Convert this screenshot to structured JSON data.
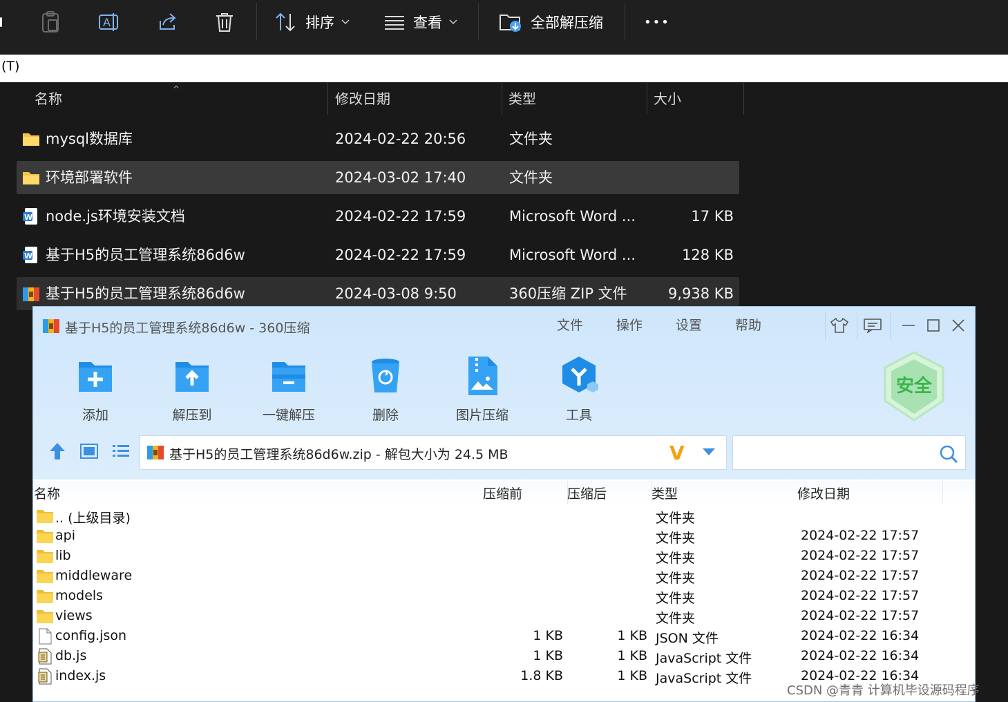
{
  "explorer": {
    "toolbar": {
      "sort_label": "排序",
      "view_label": "查看",
      "extract_all_label": "全部解压缩",
      "more_label": "•••"
    },
    "path_text": "(T)",
    "columns": {
      "name": "名称",
      "modified": "修改日期",
      "type": "类型",
      "size": "大小"
    },
    "rows": [
      {
        "name": "mysql数据库",
        "modified": "2024-02-22 20:56",
        "type": "文件夹",
        "size": "",
        "icon": "folder-icon"
      },
      {
        "name": "环境部署软件",
        "modified": "2024-03-02 17:40",
        "type": "文件夹",
        "size": "",
        "icon": "folder-icon"
      },
      {
        "name": "node.js环境安装文档",
        "modified": "2024-02-22 17:59",
        "type": "Microsoft Word ...",
        "size": "17 KB",
        "icon": "word-doc-icon"
      },
      {
        "name": "基于H5的员工管理系统86d6w",
        "modified": "2024-02-22 17:59",
        "type": "Microsoft Word ...",
        "size": "128 KB",
        "icon": "word-doc-icon"
      },
      {
        "name": "基于H5的员工管理系统86d6w",
        "modified": "2024-03-08 9:50",
        "type": "360压缩 ZIP 文件",
        "size": "9,938 KB",
        "icon": "zip-archive-icon"
      }
    ]
  },
  "zip_window": {
    "title": "基于H5的员工管理系统86d6w - 360压缩",
    "menu": [
      "文件",
      "操作",
      "设置",
      "帮助"
    ],
    "tools": [
      {
        "label": "添加",
        "icon": "add-icon"
      },
      {
        "label": "解压到",
        "icon": "extract-to-icon"
      },
      {
        "label": "一键解压",
        "icon": "one-click-extract-icon"
      },
      {
        "label": "删除",
        "icon": "delete-icon"
      },
      {
        "label": "图片压缩",
        "icon": "image-compress-icon"
      },
      {
        "label": "工具",
        "icon": "tools-icon"
      }
    ],
    "security_badge": "安全",
    "address": "基于H5的员工管理系统86d6w.zip - 解包大小为 24.5 MB",
    "address_v": "V",
    "search_placeholder": "",
    "columns": {
      "name": "名称",
      "before": "压缩前",
      "after": "压缩后",
      "type": "类型",
      "modified": "修改日期"
    },
    "rows": [
      {
        "name": ".. (上级目录)",
        "before": "",
        "after": "",
        "type": "文件夹",
        "modified": "",
        "icon": "folder-icon"
      },
      {
        "name": "api",
        "before": "",
        "after": "",
        "type": "文件夹",
        "modified": "2024-02-22 17:57",
        "icon": "folder-icon"
      },
      {
        "name": "lib",
        "before": "",
        "after": "",
        "type": "文件夹",
        "modified": "2024-02-22 17:57",
        "icon": "folder-icon"
      },
      {
        "name": "middleware",
        "before": "",
        "after": "",
        "type": "文件夹",
        "modified": "2024-02-22 17:57",
        "icon": "folder-icon"
      },
      {
        "name": "models",
        "before": "",
        "after": "",
        "type": "文件夹",
        "modified": "2024-02-22 17:57",
        "icon": "folder-icon"
      },
      {
        "name": "views",
        "before": "",
        "after": "",
        "type": "文件夹",
        "modified": "2024-02-22 17:57",
        "icon": "folder-icon"
      },
      {
        "name": "config.json",
        "before": "1 KB",
        "after": "1 KB",
        "type": "JSON 文件",
        "modified": "2024-02-22 16:34",
        "icon": "file-icon"
      },
      {
        "name": "db.js",
        "before": "1 KB",
        "after": "1 KB",
        "type": "JavaScript 文件",
        "modified": "2024-02-22 16:34",
        "icon": "script-file-icon"
      },
      {
        "name": "index.js",
        "before": "1.8 KB",
        "after": "1 KB",
        "type": "JavaScript 文件",
        "modified": "2024-02-22 16:34",
        "icon": "script-file-icon"
      }
    ]
  },
  "watermark": "CSDN @青青  计算机毕设源码程序"
}
